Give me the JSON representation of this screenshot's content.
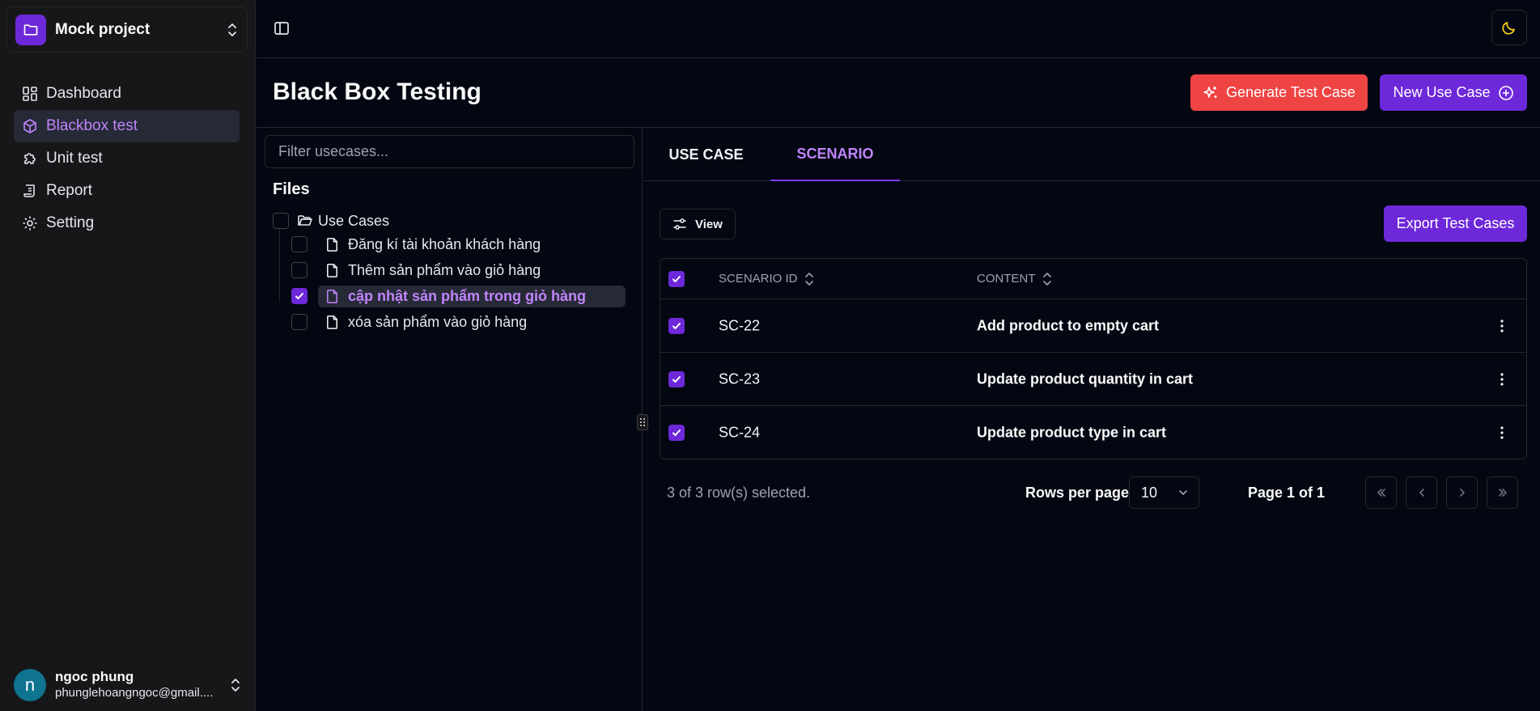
{
  "sidebar": {
    "project": {
      "name": "Mock project",
      "icon": "folder-icon"
    },
    "nav": [
      {
        "label": "Dashboard",
        "icon": "dashboard-icon",
        "active": false
      },
      {
        "label": "Blackbox test",
        "icon": "box-icon",
        "active": true
      },
      {
        "label": "Unit test",
        "icon": "puzzle-icon",
        "active": false
      },
      {
        "label": "Report",
        "icon": "scroll-icon",
        "active": false
      },
      {
        "label": "Setting",
        "icon": "gear-icon",
        "active": false
      }
    ],
    "user": {
      "initial": "n",
      "name": "ngoc phung",
      "email": "phunglehoangngoc@gmail...."
    }
  },
  "header": {
    "title": "Black Box Testing",
    "generate_label": "Generate Test Case",
    "new_usecase_label": "New Use Case"
  },
  "files": {
    "filter_placeholder": "Filter usecases...",
    "heading": "Files",
    "root": {
      "label": "Use Cases",
      "checked": false
    },
    "items": [
      {
        "label": "Đăng kí tài khoản khách hàng",
        "checked": false,
        "selected": false
      },
      {
        "label": "Thêm sản phẩm vào giỏ hàng",
        "checked": false,
        "selected": false
      },
      {
        "label": "cập nhật sản phẩm trong giỏ hàng",
        "checked": true,
        "selected": true
      },
      {
        "label": "xóa sản phẩm vào giỏ hàng",
        "checked": false,
        "selected": false
      }
    ]
  },
  "tabs": [
    {
      "label": "USE CASE",
      "active": false
    },
    {
      "label": "SCENARIO",
      "active": true
    }
  ],
  "toolbar": {
    "view_label": "View",
    "export_label": "Export Test Cases"
  },
  "table": {
    "columns": [
      "SCENARIO ID",
      "CONTENT"
    ],
    "all_checked": true,
    "rows": [
      {
        "id": "SC-22",
        "content": "Add product to empty cart",
        "checked": true
      },
      {
        "id": "SC-23",
        "content": "Update product quantity in cart",
        "checked": true
      },
      {
        "id": "SC-24",
        "content": "Update product type in cart",
        "checked": true
      }
    ]
  },
  "pagination": {
    "selected_text": "3 of 3 row(s) selected.",
    "rows_per_page_label": "Rows per page",
    "rows_per_page": "10",
    "page_text": "Page 1 of 1"
  },
  "colors": {
    "accent": "#6d28d9",
    "accent_text": "#c084fc",
    "danger": "#ef4444",
    "background": "#030712",
    "sidebar": "#17171a"
  }
}
